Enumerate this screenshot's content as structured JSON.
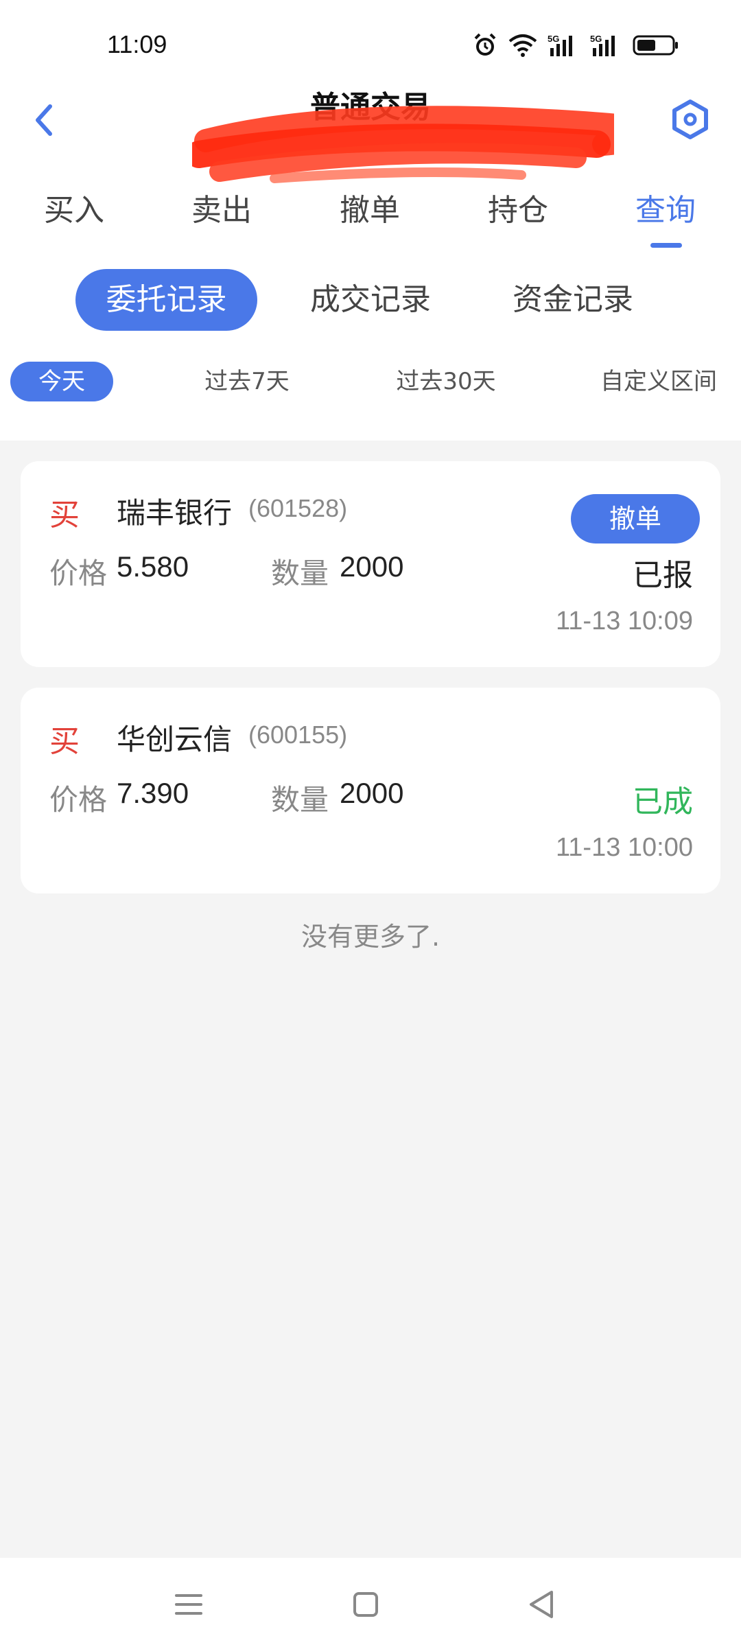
{
  "status_bar": {
    "time": "11:09",
    "icons": [
      "alarm-icon",
      "wifi-icon",
      "5g-signal-icon",
      "5g-signal-icon",
      "battery-icon"
    ],
    "net1": "5G",
    "net2": "5G"
  },
  "header": {
    "title": "普通交易",
    "back_icon": "chevron-left-icon",
    "settings_icon": "hexagon-settings-icon"
  },
  "main_tabs": [
    {
      "label": "买入"
    },
    {
      "label": "卖出"
    },
    {
      "label": "撤单"
    },
    {
      "label": "持仓"
    },
    {
      "label": "查询"
    }
  ],
  "active_main_tab": 4,
  "sub_tabs": [
    {
      "label": "委托记录"
    },
    {
      "label": "成交记录"
    },
    {
      "label": "资金记录"
    }
  ],
  "active_sub_tab": 0,
  "date_filters": [
    {
      "label": "今天"
    },
    {
      "label": "过去7天"
    },
    {
      "label": "过去30天"
    },
    {
      "label": "自定义区间"
    }
  ],
  "active_date_filter": 0,
  "orders": [
    {
      "side": "买",
      "name": "瑞丰银行",
      "code": "(601528)",
      "price_label": "价格",
      "price": "5.580",
      "qty_label": "数量",
      "qty": "2000",
      "status": "已报",
      "time": "11-13 10:09",
      "action": "撤单"
    },
    {
      "side": "买",
      "name": "华创云信",
      "code": "(600155)",
      "price_label": "价格",
      "price": "7.390",
      "qty_label": "数量",
      "qty": "2000",
      "status": "已成",
      "time": "11-13 10:00"
    }
  ],
  "footer": {
    "no_more": "没有更多了."
  },
  "nav_bar": {
    "icons": [
      "menu-icon",
      "home-square-icon",
      "back-triangle-icon"
    ]
  },
  "colors": {
    "accent": "#4a78e8",
    "buy_red": "#e2423a",
    "filled_green": "#31b65b",
    "redaction": "#ff3b1f"
  }
}
